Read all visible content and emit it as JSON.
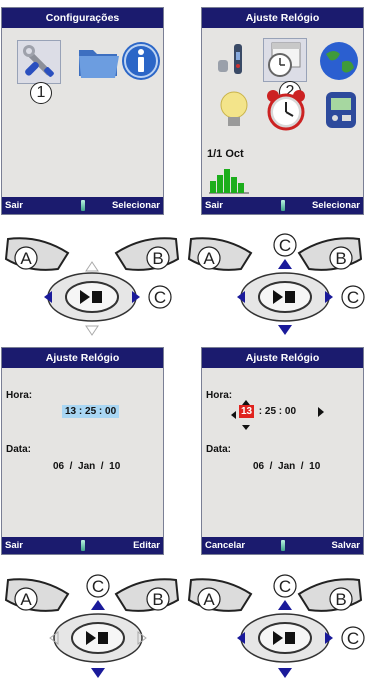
{
  "panels": [
    {
      "title": "Configurações",
      "left_soft": "Sair",
      "right_soft": "Selecionar",
      "badge": "1",
      "icons": [
        "tools-icon",
        "folder-icon",
        "info-icon"
      ]
    },
    {
      "title": "Ajuste Relógio",
      "left_soft": "Sair",
      "right_soft": "Selecionar",
      "badge": "2",
      "icons": [
        "signal-device-icon",
        "calendar-clock-icon",
        "globe-icon",
        "lightbulb-icon",
        "alarm-clock-icon",
        "battery-device-icon",
        "chart-date-icon"
      ],
      "date_label": "1/1 Oct"
    },
    {
      "title": "Ajuste Relógio",
      "hora_label": "Hora:",
      "time": "13 : 25 : 00",
      "data_label": "Data:",
      "date": "06  /  Jan  /  10",
      "left_soft": "Sair",
      "right_soft": "Editar"
    },
    {
      "title": "Ajuste Relógio",
      "hora_label": "Hora:",
      "time_hour": "13",
      "time_rest": " : 25 : 00",
      "data_label": "Data:",
      "date": "06  /  Jan  /  10",
      "left_soft": "Cancelar",
      "right_soft": "Salvar"
    }
  ],
  "controls": {
    "btn_a": "A",
    "btn_b": "B",
    "btn_c": "C",
    "play_stop_icon": "play-stop-icon"
  },
  "colors": {
    "title_bar": "#1b1b6e",
    "screen_bg": "#e5e4e2",
    "time_highlight": "#a9d6f3",
    "hour_edit": "#e0231e"
  }
}
